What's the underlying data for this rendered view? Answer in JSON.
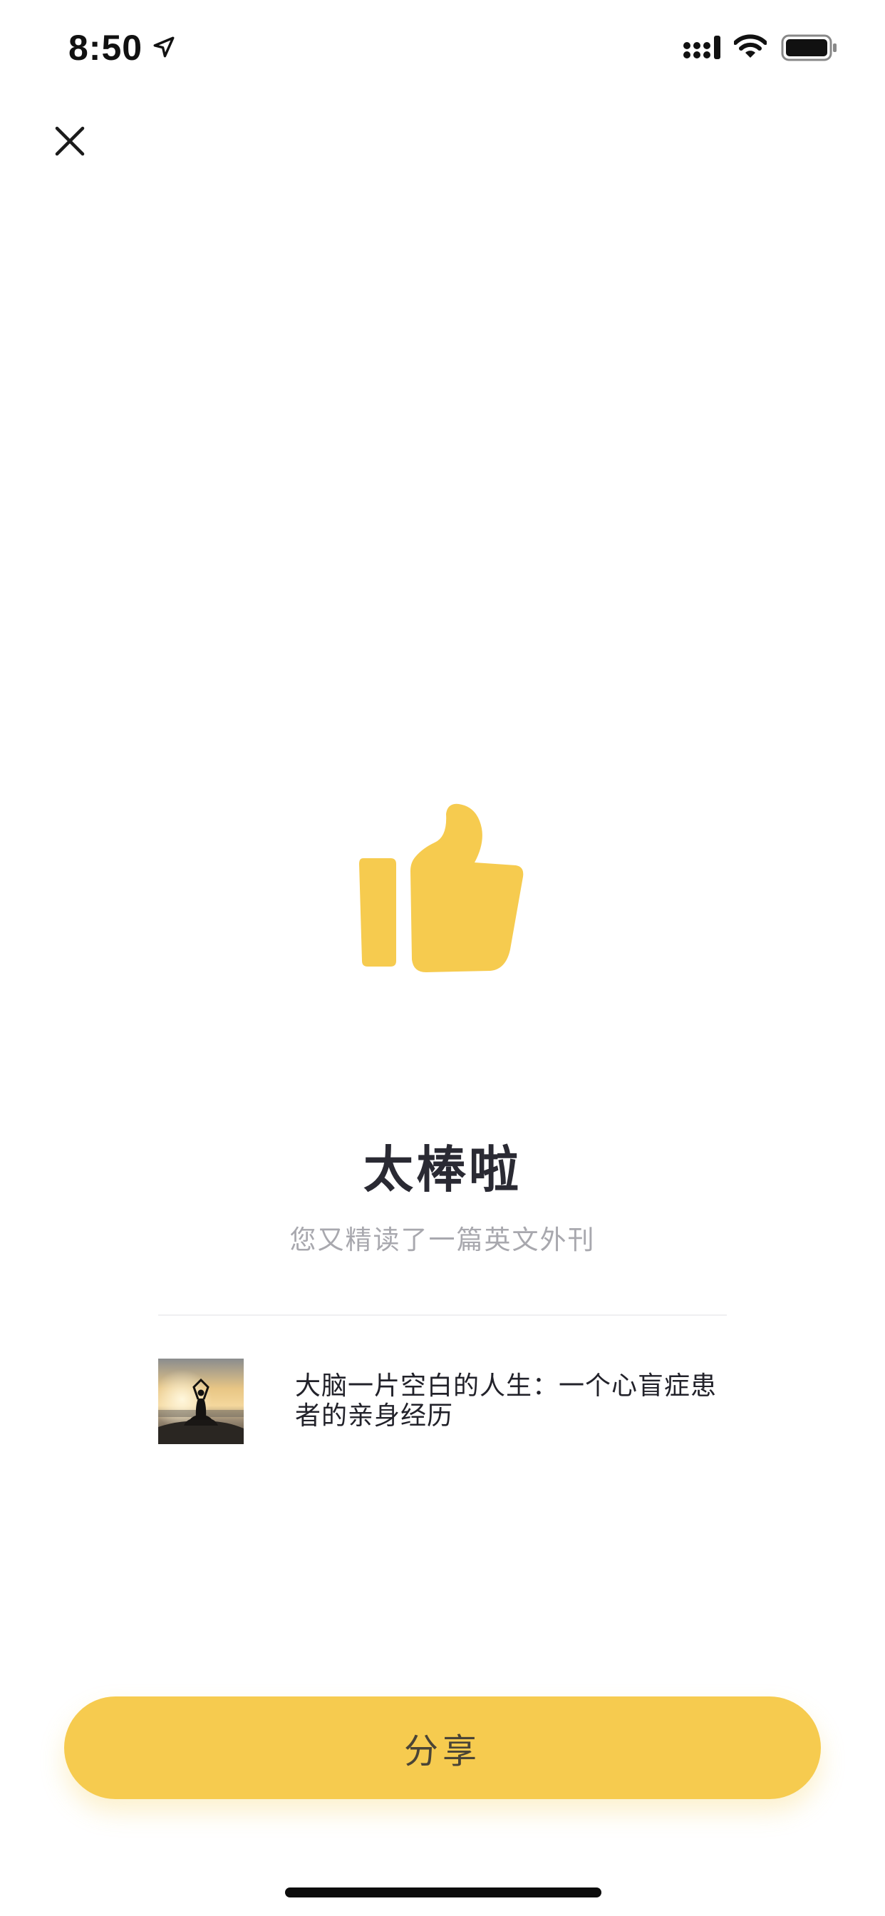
{
  "status_bar": {
    "time": "8:50",
    "icons": [
      "location-arrow-icon",
      "cellular-signal-icon",
      "wifi-icon",
      "battery-icon"
    ]
  },
  "header": {
    "close_icon": "close-icon"
  },
  "hero": {
    "icon": "thumbs-up-icon",
    "accent_color": "#F6CB4F",
    "title": "太棒啦",
    "subtitle": "您又精读了一篇英文外刊"
  },
  "article": {
    "title": "大脑一片空白的人生：一个心盲症患者的亲身经历"
  },
  "actions": {
    "share_label": "分享"
  }
}
